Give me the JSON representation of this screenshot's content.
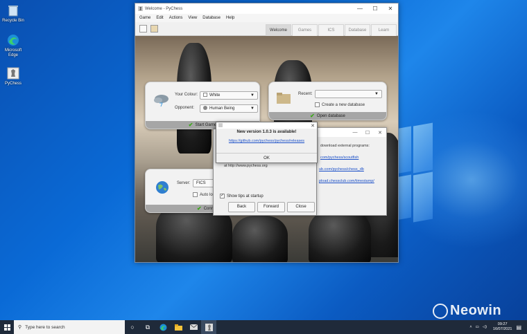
{
  "desktop": {
    "icons": [
      {
        "label": "Recycle Bin"
      },
      {
        "label": "Microsoft Edge"
      },
      {
        "label": "PyChess"
      }
    ],
    "watermark": "Neowin"
  },
  "window": {
    "title": "Welcome - PyChess",
    "controls": {
      "min": "—",
      "max": "☐",
      "close": "✕"
    },
    "menu": [
      "Game",
      "Edit",
      "Actions",
      "View",
      "Database",
      "Help"
    ],
    "tabs": [
      "Welcome",
      "Games",
      "ICS",
      "Database",
      "Learn"
    ],
    "active_tab": "Welcome"
  },
  "new_game_panel": {
    "colour_label": "Your Colour:",
    "colour_value": "White",
    "opponent_label": "Opponent:",
    "opponent_value": "Human Being",
    "button": "Start Game"
  },
  "open_db_panel": {
    "recent_label": "Recent:",
    "recent_value": "",
    "create_checkbox": "Create a new database",
    "button": "Open database"
  },
  "ics_panel": {
    "server_label": "Server:",
    "server_value": "FICS",
    "autologin": "Auto login",
    "button": "Connect"
  },
  "external_dialog": {
    "text": "download external programs:",
    "links": [
      "com/pychess/scoutfish",
      "ub.com/pychess/chess_db",
      "pload.chessclub.com/timestamp/"
    ]
  },
  "tips_dialog": {
    "site_text": "at http://www.pychess.org",
    "show_tips": "Show tips at startup",
    "buttons": [
      "Back",
      "Forward",
      "Close"
    ]
  },
  "new_version_dialog": {
    "heading": "New version 1.0.3 is available!",
    "link": "https://github.com/pychess/pychess/releases",
    "ok": "OK",
    "close": "✕"
  },
  "taskbar": {
    "search_placeholder": "Type here to search",
    "time": "09:27",
    "date": "16/07/2021"
  }
}
